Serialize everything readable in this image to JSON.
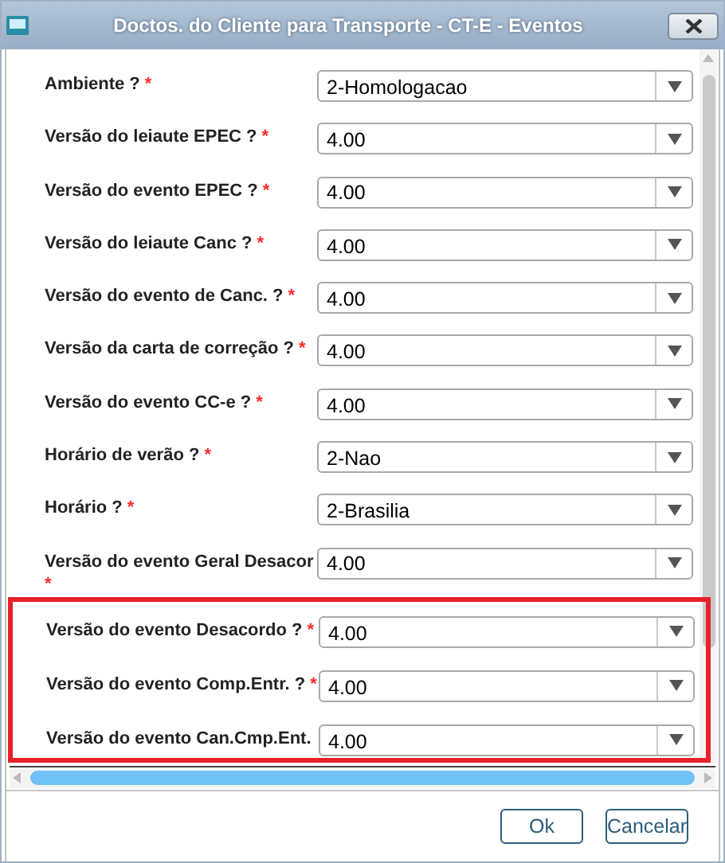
{
  "window": {
    "title": "Doctos. do Cliente para Transporte - CT-E - Eventos"
  },
  "fields": [
    {
      "label": "Ambiente ?",
      "required_mark": "*",
      "kind": "inline",
      "value": "2-Homologacao"
    },
    {
      "label": "Versão do leiaute EPEC ?",
      "required_mark": "*",
      "kind": "inline",
      "value": "4.00"
    },
    {
      "label": "Versão do evento EPEC ?",
      "required_mark": "*",
      "kind": "inline",
      "value": "4.00"
    },
    {
      "label": "Versão do leiaute Canc ?",
      "required_mark": "*",
      "kind": "inline",
      "value": "4.00"
    },
    {
      "label": "Versão do evento de Canc. ?",
      "required_mark": "*",
      "kind": "inline",
      "value": "4.00"
    },
    {
      "label": "Versão da carta de correção ?",
      "required_mark": "*",
      "kind": "inline",
      "value": "4.00"
    },
    {
      "label": "Versão do evento CC-e ?",
      "required_mark": "*",
      "kind": "inline",
      "value": "4.00"
    },
    {
      "label": "Horário de verão ?",
      "required_mark": "*",
      "kind": "inline",
      "value": "2-Nao"
    },
    {
      "label": "Horário ?",
      "required_mark": "*",
      "kind": "inline",
      "value": "2-Brasilia"
    },
    {
      "label": "Versão do evento Geral Desacor",
      "required_mark": "*",
      "kind": "wrapped",
      "value": "4.00"
    }
  ],
  "highlighted_fields": [
    {
      "label": "Versão do evento Desacordo ?",
      "required_mark": "*",
      "value": "4.00"
    },
    {
      "label": "Versão do evento Comp.Entr. ?",
      "required_mark": "*",
      "value": "4.00"
    },
    {
      "label": "Versão do evento Can.Cmp.Ent.",
      "value": "4.00"
    }
  ],
  "buttons": [
    "Ok",
    "Cancelar"
  ]
}
